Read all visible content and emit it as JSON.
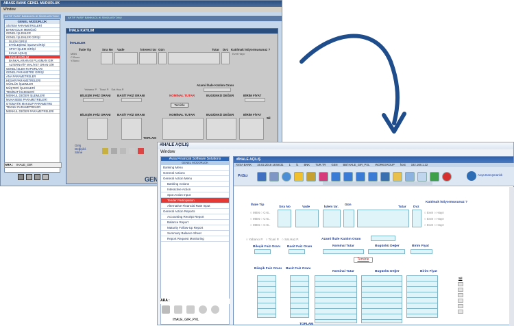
{
  "window1": {
    "title": "ABASE BANK GENEL MUDURLUK",
    "menu": "Window",
    "side_header": "AKTIF PASIF BANKACILIK SİMÜLASYONU",
    "side_title": "GENEL MÜDÜRLÜK",
    "items": [
      "SİSTEM PARAMETRELERİ",
      "BANKACILIK MENÜSÜ",
      "GENEL İŞLEMLER",
      "GENEL İŞLEMLER GİRİŞİ",
      "İŞLEM GİRİŞİ",
      "ETKİLEŞİMLİ İŞLEM GİRİŞİ",
      "SPOT İŞLEM GİRİŞİ",
      "İHALE AÇILIŞ",
      "İHALE KATILIM",
      "BANKALARARASI PLASMAN GİR",
      "ALTERNATİF MALİYET ORAN GİR",
      "GENEL İŞLEM RAPORLARI",
      "GENEL PARAMETRE GİRİŞİ",
      "ANA PARAMETRELER",
      "HESAP PARAMETRELERİ",
      "GÜNLÜK İŞLEMLER",
      "MÜŞTERİ İŞLEMLERİ",
      "TEMİNAT İŞLEMLERİ",
      "MENKUL DEĞER İŞLEMLERİ",
      "MUHASEBE PARAMETRELERİ",
      "OTOMATİK MAKSUP PARAMETRE",
      "TEKNİK PARAMETRELER",
      "MENKUL DEĞER PARAMETRELERİ"
    ],
    "ara_value": "IHALE_GIR",
    "ara_label": "ARA :",
    "inner_title": "İHALE KATILIM",
    "header_strip": "AKTIF PASIF BANKACILIK SİMÜLASYONU",
    "section": "İHALELER",
    "cols": [
      "İhale Tip",
      "Sıra No",
      "Vade",
      "İnterest tar",
      "Gün",
      "Tutar",
      "Dvz",
      "Katılmak İstiyormusunuz ?"
    ],
    "radio": [
      "MBN",
      "C.Bono",
      "Y.Bono"
    ],
    "yn": [
      "Evet",
      "Hayır"
    ],
    "katilim": "Azami İhale Katılım Oranı",
    "rads": [
      "Yabancı P.",
      "Ticari P.",
      "Sat.Haz.P."
    ],
    "h1": [
      "BİLEŞİK FAİZ ORANI",
      "BASİT FAİZ ORANI",
      "NOMİNAL TUTAR",
      "BUGÜNKÜ DEĞER",
      "BİRİM FİYAT"
    ],
    "temizle": "Temizle",
    "toplam": "TOPLAM",
    "opts": [
      "Giriş",
      "Değişikl.",
      "Silme"
    ],
    "bottom": "GEN",
    "sh": "Sil"
  },
  "window2": {
    "title": "#İHALE AÇILIŞ",
    "menu": "Window",
    "side_header": "Avsa Financial Software Solutions",
    "side_sub": "GENEL MÜDÜRLÜK",
    "items": [
      "Banking Menu",
      "General Actions",
      "General Action Menu",
      "Banking Actions",
      "Interactive Action",
      "Spot Action Input",
      "Tender Participation",
      "Alternative Financial Rate Input",
      "General Action Reports",
      "Accounting Receipt Report",
      "Balance Report",
      "Maturity Follow-Up Report",
      "Summary Balance Sheet",
      "Report Request Monitoring"
    ],
    "ara_label": "ARA :",
    "ara_value": "IHALE_GIR_PXL",
    "inner_title": "#İHALE AÇILIŞ",
    "status": [
      "AVSA BANK",
      "16.02.2018 18:58:31",
      "1",
      "/1",
      "BNK",
      "TUR.TR",
      "GEN",
      "BB İHALE_GIR_PXL",
      "WORKGROUP",
      "host",
      "192.168.1.22"
    ],
    "prtscr": "PrtScr",
    "brand": "Avşa Danışmanlık",
    "cols": [
      "İhale Tip",
      "Sıra No",
      "Vade",
      "İşlem tar.",
      "Gün",
      "Tutar",
      "Dvz",
      "Katılmak İstiyormusunuz ?"
    ],
    "radio": [
      "MBN",
      "C-B..",
      "Y-B.."
    ],
    "yn": [
      "Evet",
      "Hayır"
    ],
    "rads": [
      "Yabancı P.",
      "Ticari P.",
      "Sat.Haz.P."
    ],
    "katilim": "Azami İhale Katılım Oranı",
    "h1": [
      "Bileşik Faiz Oranı",
      "Basit Faiz Oranı",
      "Nominal Tutar",
      "Bugünkü Değer",
      "Birim Fiyat"
    ],
    "temizle": "Temizle",
    "h2": [
      "Bileşik Faiz Oranı",
      "Basit Faiz Oranı",
      "Nominal Tutar",
      "Bugünkü Değer",
      "Birim Fiyat"
    ],
    "toplam": "TOPLAM",
    "sh": "Sil"
  }
}
